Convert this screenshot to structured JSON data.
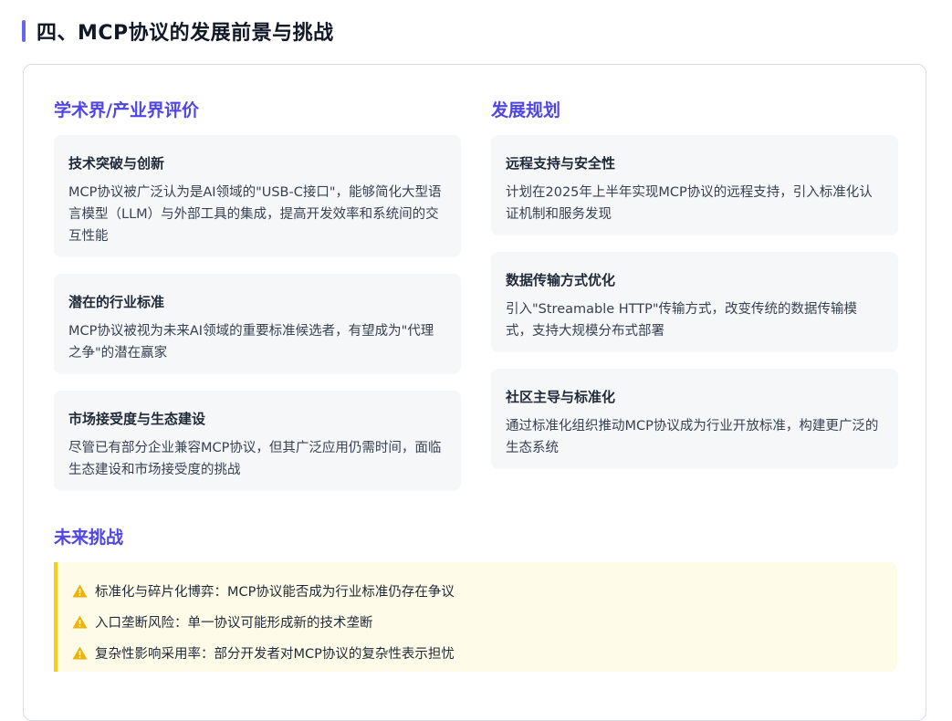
{
  "page": {
    "title": "四、MCP协议的发展前景与挑战",
    "accent_color": "#4f46e5"
  },
  "evaluation": {
    "heading": "学术界/产业界评价",
    "cards": [
      {
        "title": "技术突破与创新",
        "body": "MCP协议被广泛认为是AI领域的\"USB-C接口\"，能够简化大型语言模型（LLM）与外部工具的集成，提高开发效率和系统间的交互性能"
      },
      {
        "title": "潜在的行业标准",
        "body": "MCP协议被视为未来AI领域的重要标准候选者，有望成为\"代理之争\"的潜在赢家"
      },
      {
        "title": "市场接受度与生态建设",
        "body": "尽管已有部分企业兼容MCP协议，但其广泛应用仍需时间，面临生态建设和市场接受度的挑战"
      }
    ]
  },
  "roadmap": {
    "heading": "发展规划",
    "cards": [
      {
        "title": "远程支持与安全性",
        "body": "计划在2025年上半年实现MCP协议的远程支持，引入标准化认证机制和服务发现"
      },
      {
        "title": "数据传输方式优化",
        "body": "引入\"Streamable HTTP\"传输方式，改变传统的数据传输模式，支持大规模分布式部署"
      },
      {
        "title": "社区主导与标准化",
        "body": "通过标准化组织推动MCP协议成为行业开放标准，构建更广泛的生态系统"
      }
    ]
  },
  "challenges": {
    "heading": "未来挑战",
    "icon": "warning-icon",
    "items": [
      "标准化与碎片化博弈：MCP协议能否成为行业标准仍存在争议",
      "入口垄断风险：单一协议可能形成新的技术垄断",
      "复杂性影响采用率：部分开发者对MCP协议的复杂性表示担忧"
    ]
  }
}
